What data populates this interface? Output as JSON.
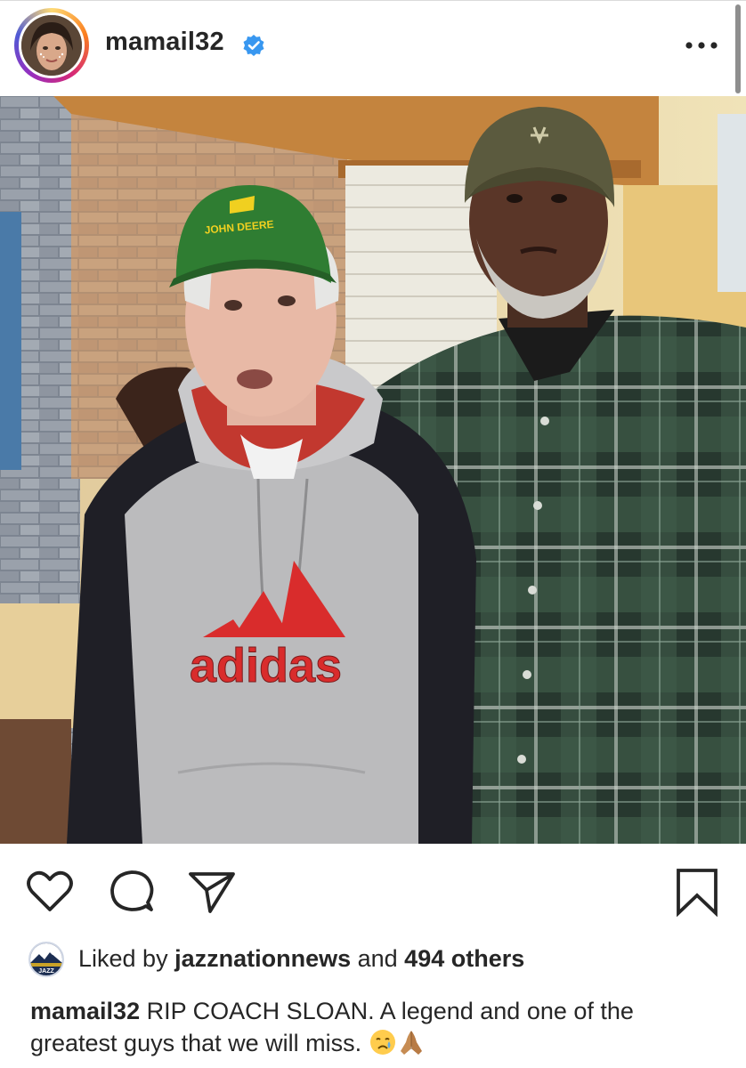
{
  "post": {
    "username": "mamail32",
    "verified_icon": "verified-badge-icon",
    "more_icon": "more-options-icon"
  },
  "actions": {
    "like_icon": "heart-icon",
    "comment_icon": "comment-icon",
    "share_icon": "paper-plane-icon",
    "save_icon": "bookmark-icon"
  },
  "likes": {
    "prefix": "Liked by ",
    "user": "jazznationnews",
    "connector": " and ",
    "others": "494 others",
    "avatar_text": "JAZZ"
  },
  "caption": {
    "username": "mamail32",
    "text": " RIP COACH SLOAN. A legend and one of the greatest guys that we will miss. ",
    "emojis": [
      "crying-face-emoji",
      "folded-hands-emoji"
    ]
  },
  "photo": {
    "cap_text": "JOHN DEERE",
    "shirt_text": "adidas"
  },
  "colors": {
    "verified_blue": "#3897f0",
    "text": "#262626",
    "adidas_red": "#d92c2c",
    "cap_green": "#2f7d32"
  }
}
